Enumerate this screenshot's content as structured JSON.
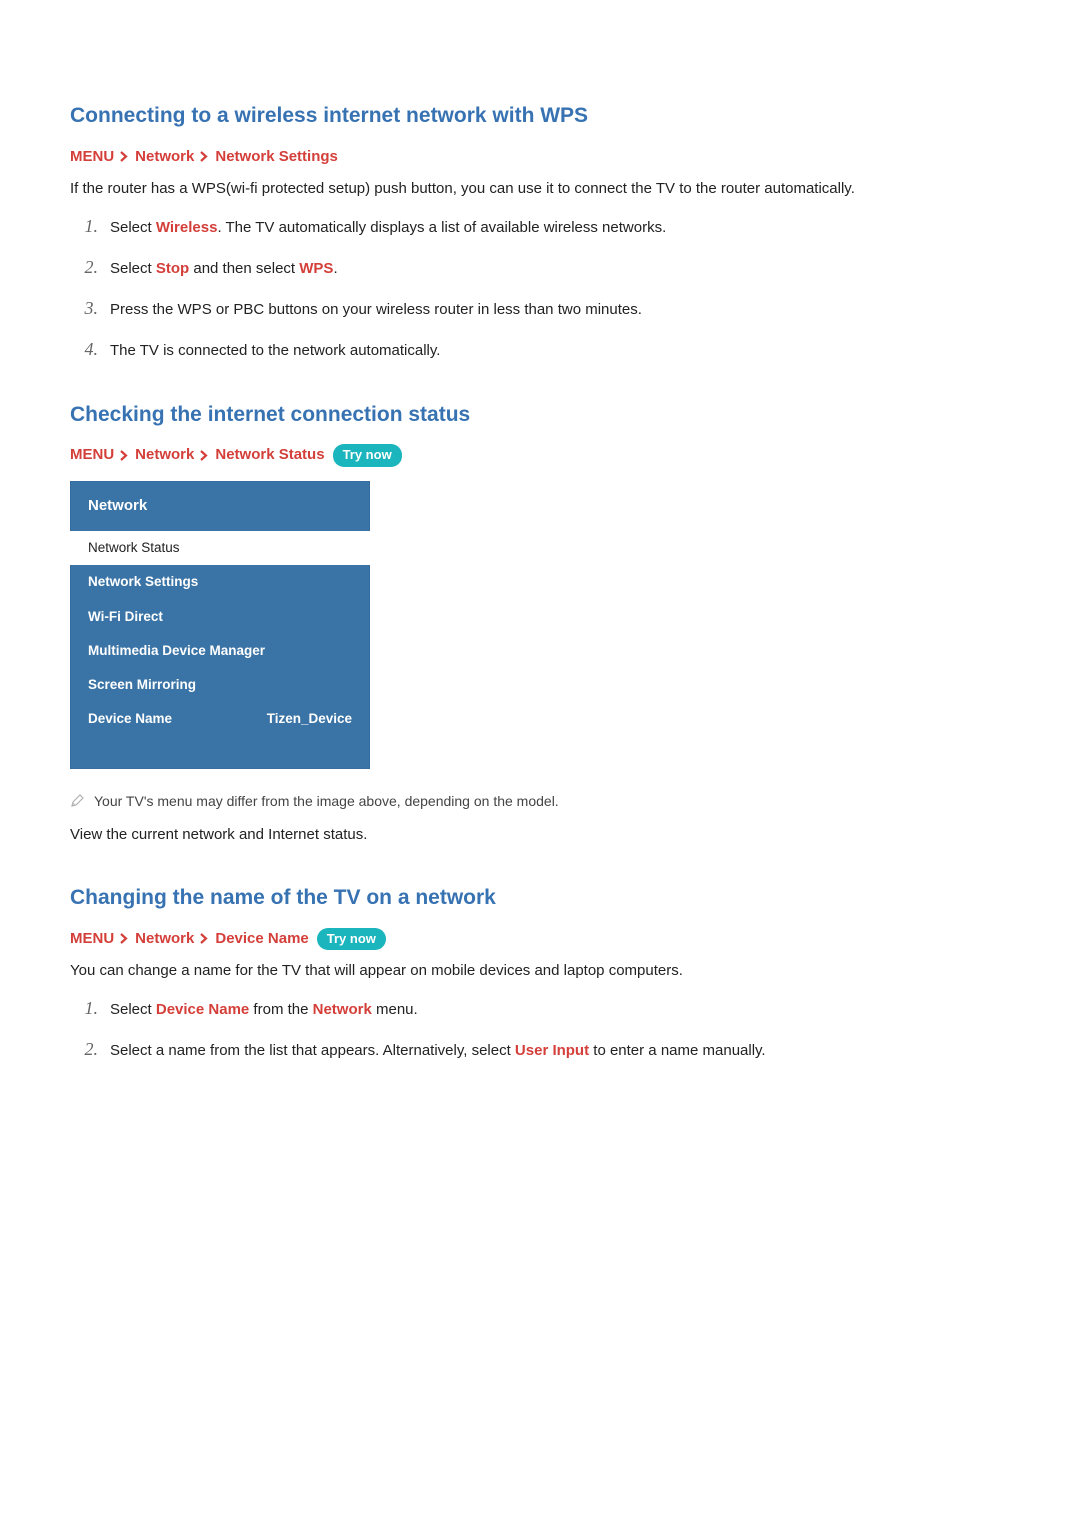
{
  "sections": {
    "wps": {
      "title": "Connecting to a wireless internet network with WPS",
      "crumbs": [
        "MENU",
        "Network",
        "Network Settings"
      ],
      "intro": "If the router has a WPS(wi-fi protected setup) push button, you can use it to connect the TV to the router automatically.",
      "steps": [
        {
          "pre": "Select ",
          "kw": "Wireless",
          "post": ". The TV automatically displays a list of available wireless networks."
        },
        {
          "pre": "Select ",
          "kw": "Stop",
          "mid": " and then select ",
          "kw2": "WPS",
          "post": "."
        },
        {
          "pre": "Press the WPS or PBC buttons on your wireless router in less than two minutes.",
          "kw": "",
          "post": ""
        },
        {
          "pre": "The TV is connected to the network automatically.",
          "kw": "",
          "post": ""
        }
      ]
    },
    "status": {
      "title": "Checking the internet connection status",
      "crumbs": [
        "MENU",
        "Network",
        "Network Status"
      ],
      "trynow": "Try now",
      "panel": {
        "title": "Network",
        "items": [
          {
            "label": "Network Status",
            "selected": true
          },
          {
            "label": "Network Settings"
          },
          {
            "label": "Wi-Fi Direct"
          },
          {
            "label": "Multimedia Device Manager"
          },
          {
            "label": "Screen Mirroring"
          },
          {
            "label": "Device Name",
            "value": "Tizen_Device"
          }
        ]
      },
      "note": "Your TV's menu may differ from the image above, depending on the model.",
      "body": "View the current network and Internet status."
    },
    "devname": {
      "title": "Changing the name of the TV on a network",
      "crumbs": [
        "MENU",
        "Network",
        "Device Name"
      ],
      "trynow": "Try now",
      "intro": "You can change a name for the TV that will appear on mobile devices and laptop computers.",
      "steps": [
        {
          "pre": "Select ",
          "kw": "Device Name",
          "mid": " from the ",
          "kw2": "Network",
          "post": " menu."
        },
        {
          "pre": "Select a name from the list that appears. Alternatively, select ",
          "kw": "User Input",
          "post": " to enter a name manually."
        }
      ]
    }
  }
}
